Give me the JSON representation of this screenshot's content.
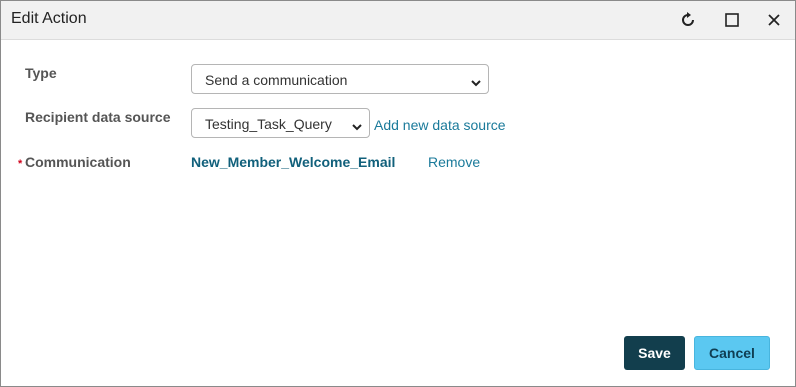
{
  "dialog": {
    "title": "Edit Action",
    "icons": {
      "refresh": "refresh-icon",
      "maximize": "maximize-icon",
      "close": "close-icon"
    }
  },
  "form": {
    "type": {
      "label": "Type",
      "value": "Send a communication"
    },
    "recipient": {
      "label": "Recipient data source",
      "value": "Testing_Task_Query",
      "add_link": "Add new data source"
    },
    "communication": {
      "required_mark": "*",
      "label": "Communication",
      "value": "New_Member_Welcome_Email",
      "remove_link": "Remove"
    }
  },
  "buttons": {
    "save": "Save",
    "cancel": "Cancel"
  },
  "colors": {
    "save_bg": "#123e4d",
    "cancel_bg": "#5bc8f1",
    "link": "#1a7a9a",
    "required": "#d0021b"
  }
}
